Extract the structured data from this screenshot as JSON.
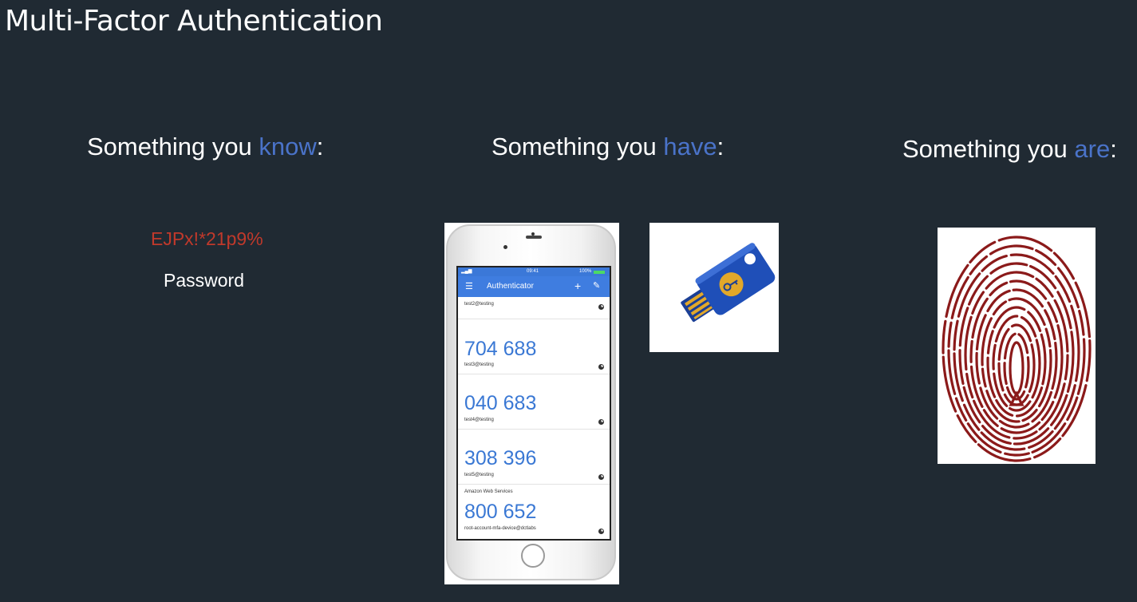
{
  "slide": {
    "title": "Multi-Factor Authentication"
  },
  "factors": [
    {
      "prefix": "Something you ",
      "keyword": "know",
      "suffix": ":"
    },
    {
      "prefix": "Something you ",
      "keyword": "have",
      "suffix": ":"
    },
    {
      "prefix": "Something you ",
      "keyword": "are",
      "suffix": ":"
    }
  ],
  "know": {
    "example_password": "EJPx!*21p9%",
    "label": "Password"
  },
  "phone": {
    "status_time": "09:41",
    "status_battery": "100%",
    "app_title": "Authenticator",
    "entries": [
      {
        "code": "",
        "issuer": "",
        "account": "test2@testing"
      },
      {
        "code": "704 688",
        "issuer": "",
        "account": "test3@testing"
      },
      {
        "code": "040 683",
        "issuer": "",
        "account": "test4@testing"
      },
      {
        "code": "308 396",
        "issuer": "",
        "account": "test5@testing"
      },
      {
        "code": "800 652",
        "issuer": "Amazon Web Services",
        "account": "root-account-mfa-device@dctlabs"
      }
    ]
  },
  "colors": {
    "background": "#202a33",
    "keyword": "#4a73c9",
    "password": "#c0392b",
    "app_bar": "#3f7de0",
    "code": "#3a78d4",
    "key_blue": "#1f4fb8",
    "key_gold": "#e2a82a",
    "fingerprint": "#8b1a1a"
  },
  "icons": {
    "menu": "hamburger-menu-icon",
    "add": "plus-icon",
    "edit": "pencil-icon",
    "timer": "countdown-timer-icon",
    "home": "home-button-icon"
  }
}
